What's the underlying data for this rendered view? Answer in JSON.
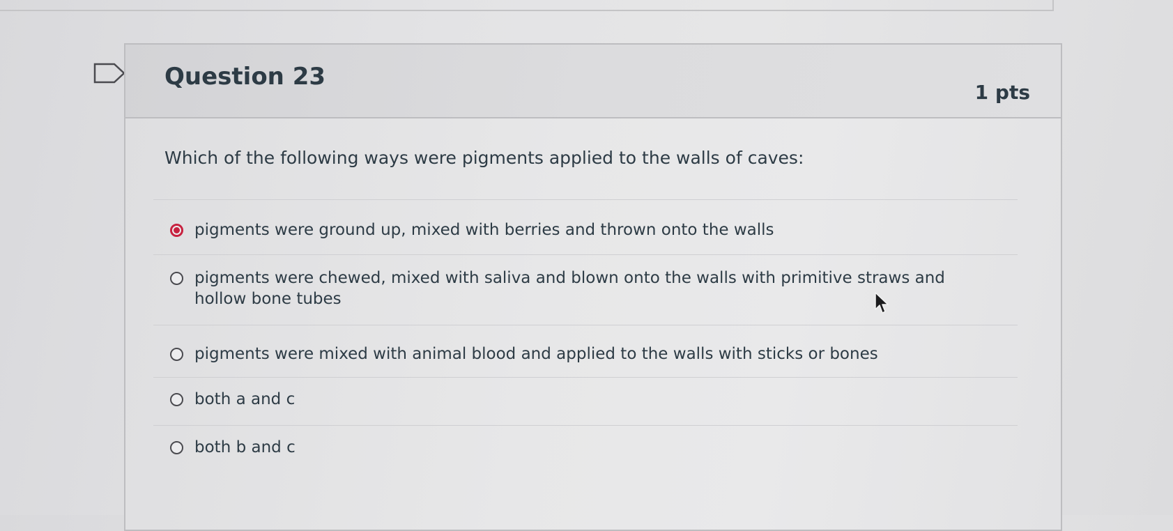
{
  "question": {
    "title": "Question 23",
    "points": "1 pts",
    "text": "Which of the following ways were pigments applied to the walls of caves:",
    "selected_index": 0,
    "answers": [
      {
        "label": "pigments were ground up, mixed with berries and thrown onto the walls"
      },
      {
        "label": "pigments were chewed, mixed with saliva and blown onto the walls with primitive straws and hollow bone tubes"
      },
      {
        "label": "pigments were mixed with animal blood and applied to the walls with sticks or bones"
      },
      {
        "label": "both a and c"
      },
      {
        "label": "both b and c"
      }
    ]
  },
  "icons": {
    "flag": "flag-question-icon",
    "cursor": "mouse-pointer-icon"
  },
  "colors": {
    "selected_radio": "#c7213f",
    "text": "#2d3b45",
    "border": "#bdbdc0"
  }
}
